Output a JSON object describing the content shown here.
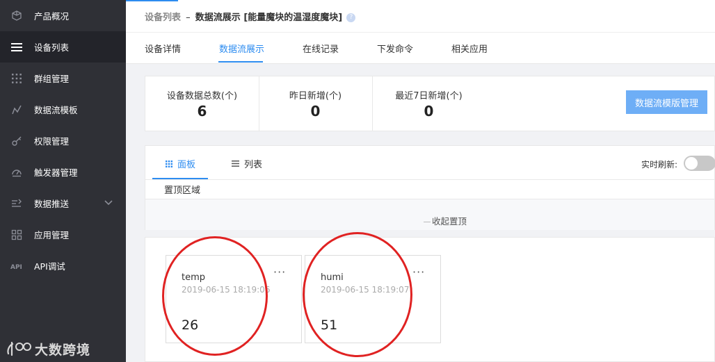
{
  "sidebar": {
    "items": [
      {
        "label": "产品概况",
        "icon": "cube-icon"
      },
      {
        "label": "设备列表",
        "icon": "list-icon",
        "active": true
      },
      {
        "label": "群组管理",
        "icon": "grid-dots-icon"
      },
      {
        "label": "数据流模板",
        "icon": "chart-line-icon"
      },
      {
        "label": "权限管理",
        "icon": "key-icon"
      },
      {
        "label": "触发器管理",
        "icon": "gauge-icon"
      },
      {
        "label": "数据推送",
        "icon": "push-icon",
        "has_chevron": true
      },
      {
        "label": "应用管理",
        "icon": "apps-icon"
      },
      {
        "label": "API调试",
        "icon": "api-icon"
      }
    ],
    "watermark": "大数跨境"
  },
  "header": {
    "breadcrumb_root": "设备列表",
    "breadcrumb_sep": "–",
    "breadcrumb_current": "数据流展示 [能量魔块的温湿度魔块]",
    "tabs": [
      "设备详情",
      "数据流展示",
      "在线记录",
      "下发命令",
      "相关应用"
    ],
    "active_tab": 1
  },
  "stats": {
    "items": [
      {
        "label": "设备数据总数(个)",
        "value": "6"
      },
      {
        "label": "昨日新增(个)",
        "value": "0"
      },
      {
        "label": "最近7日新增(个)",
        "value": "0"
      }
    ],
    "manage_button": "数据流模版管理"
  },
  "panel": {
    "view_tabs": [
      "面板",
      "列表"
    ],
    "pin_area_label": "置顶区域",
    "collapse_label": "收起置顶",
    "refresh_label": "实时刷新:",
    "refresh_on": false
  },
  "datastreams": [
    {
      "name": "temp",
      "time": "2019-06-15 18:19:06",
      "value": "26",
      "more": "···"
    },
    {
      "name": "humi",
      "time": "2019-06-15 18:19:07",
      "value": "51",
      "more": "···"
    }
  ],
  "colors": {
    "sidebar_bg": "#2f3036",
    "accent": "#2d8cf0",
    "button": "#6eaef6",
    "annotation": "#e02222"
  }
}
